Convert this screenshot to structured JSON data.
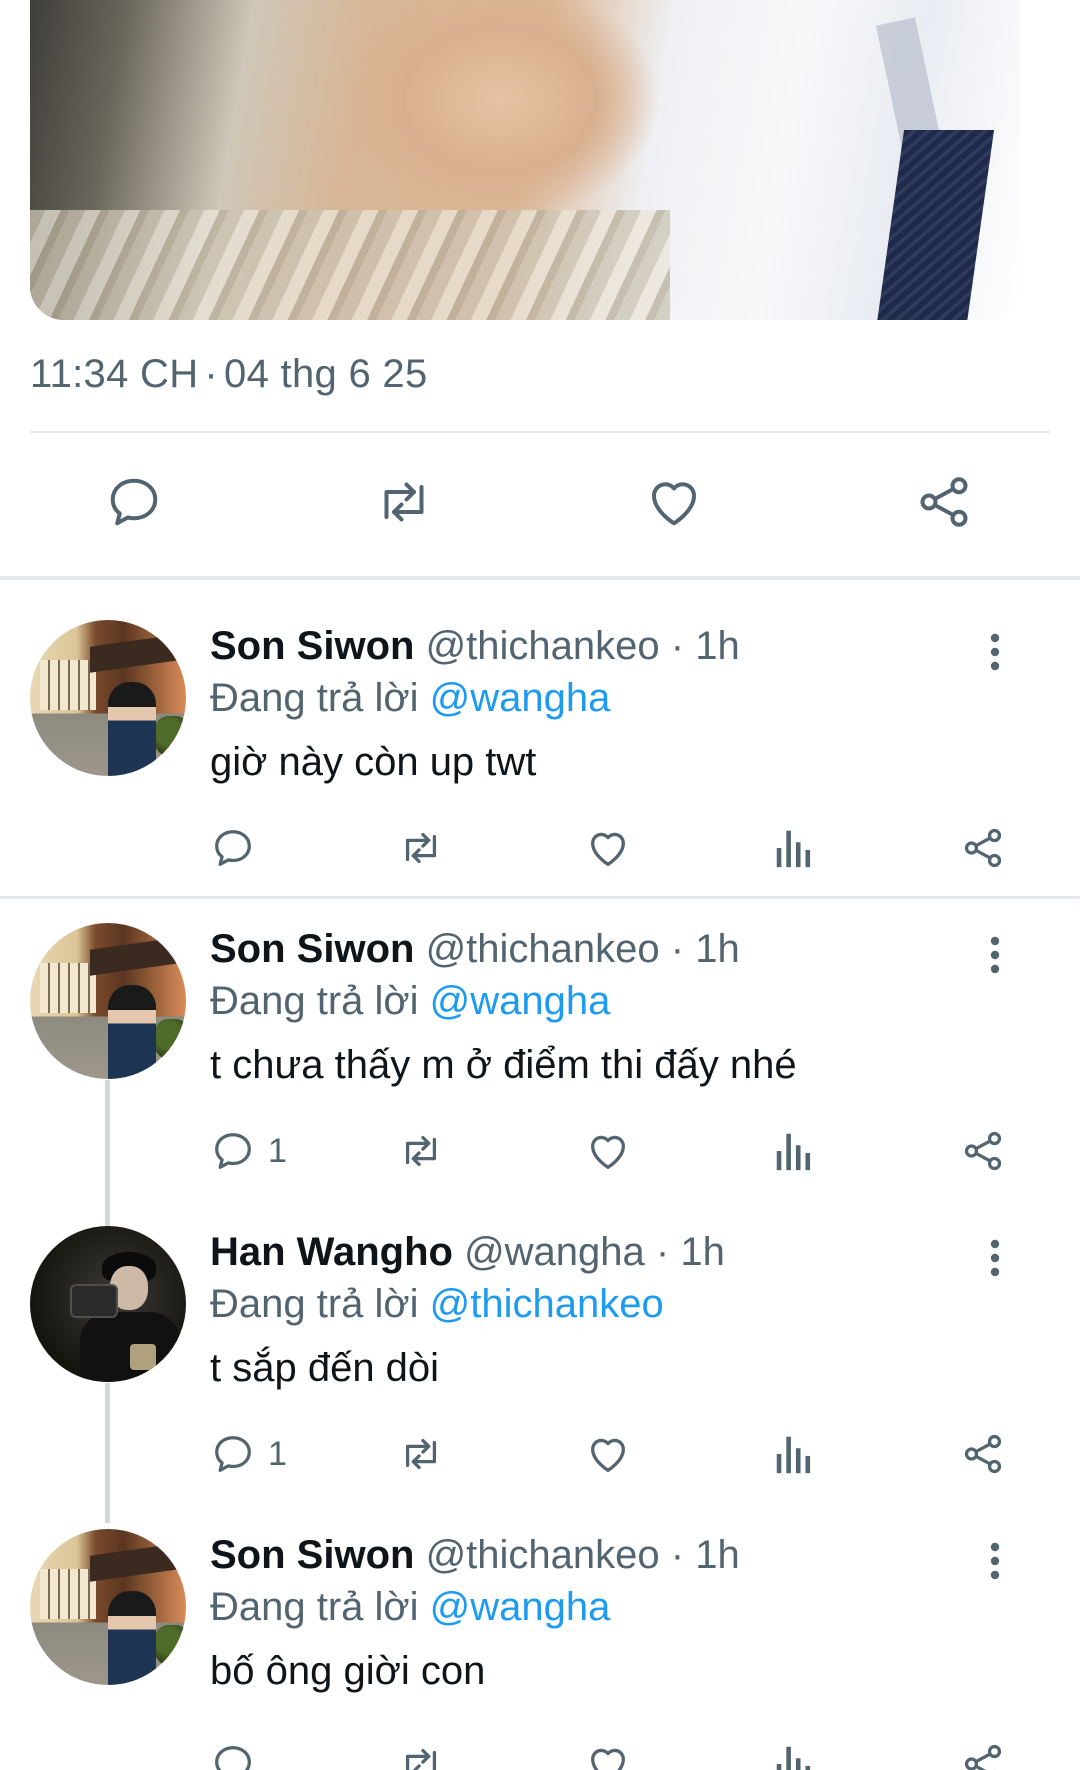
{
  "main_tweet": {
    "timestamp_time": "11:34 CH",
    "timestamp_sep": "·",
    "timestamp_date": "04 thg 6 25"
  },
  "replies": [
    {
      "name": "Son Siwon",
      "handle": "@thichankeo",
      "sep": "·",
      "time": "1h",
      "replying_prefix": "Đang trả lời",
      "replying_to": "@wangha",
      "text": "giờ này còn up twt",
      "reply_count": ""
    },
    {
      "name": "Son Siwon",
      "handle": "@thichankeo",
      "sep": "·",
      "time": "1h",
      "replying_prefix": "Đang trả lời",
      "replying_to": "@wangha",
      "text": "t chưa thấy m ở điểm thi đấy nhé",
      "reply_count": "1"
    },
    {
      "name": "Han Wangho",
      "handle": "@wangha",
      "sep": "·",
      "time": "1h",
      "replying_prefix": "Đang trả lời",
      "replying_to": "@thichankeo",
      "text": "t sắp đến dòi",
      "reply_count": "1"
    },
    {
      "name": "Son Siwon",
      "handle": "@thichankeo",
      "sep": "·",
      "time": "1h",
      "replying_prefix": "Đang trả lời",
      "replying_to": "@wangha",
      "text": "bố ông giời con",
      "reply_count": ""
    }
  ],
  "icons": {
    "reply": "reply-bubble-icon",
    "retweet": "retweet-icon",
    "like": "heart-icon",
    "views": "bar-chart-icon",
    "share": "share-icon",
    "more": "more-vertical-icon"
  },
  "colors": {
    "text_primary": "#0f1419",
    "text_secondary": "#536471",
    "accent": "#1d9bf0",
    "divider": "#e6e9ec"
  }
}
